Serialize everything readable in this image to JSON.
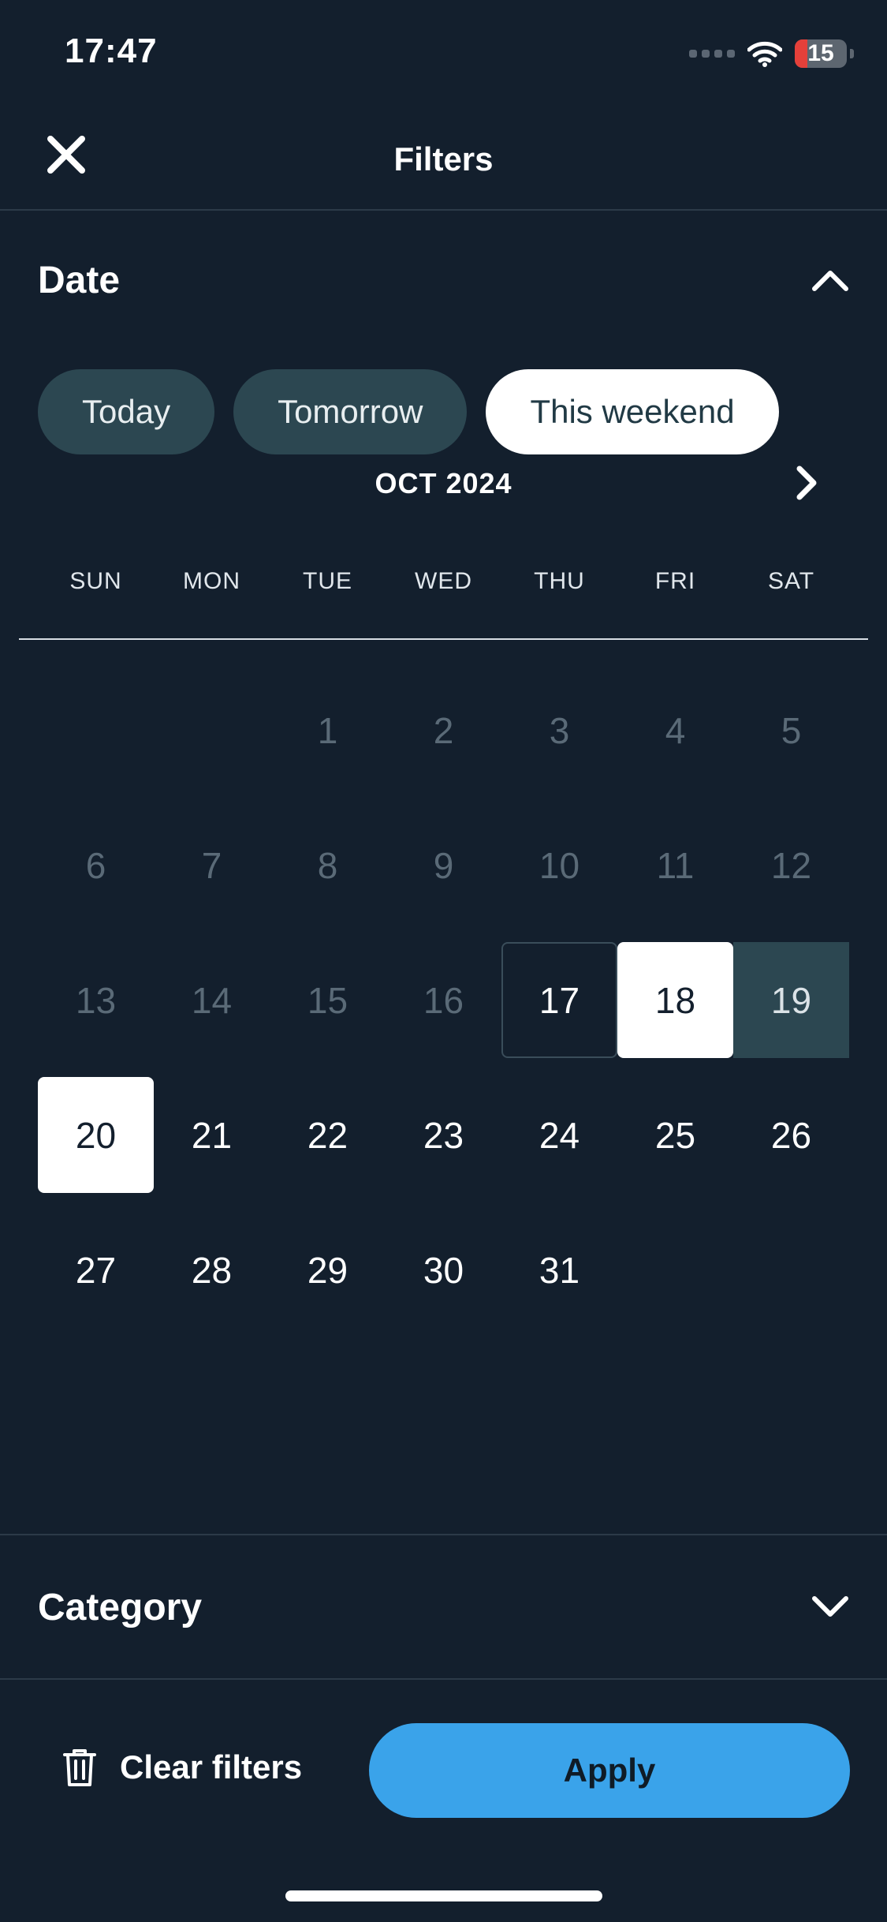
{
  "status": {
    "time": "17:47",
    "battery": "15"
  },
  "header": {
    "title": "Filters"
  },
  "date_section": {
    "title": "Date",
    "chips": [
      {
        "label": "Today",
        "selected": false
      },
      {
        "label": "Tomorrow",
        "selected": false
      },
      {
        "label": "This weekend",
        "selected": true
      }
    ],
    "month_label": "OCT 2024",
    "weekdays": [
      "SUN",
      "MON",
      "TUE",
      "WED",
      "THU",
      "FRI",
      "SAT"
    ],
    "leading_blanks": 2,
    "days_in_month": 31,
    "today": 17,
    "range_start": 18,
    "range_end": 20,
    "muted_through": 16
  },
  "category_section": {
    "title": "Category"
  },
  "footer": {
    "clear_label": "Clear filters",
    "apply_label": "Apply"
  },
  "colors": {
    "background": "#131f2d",
    "accent": "#3aa3ea",
    "chip_dark": "#2c4751",
    "muted_text": "#5a6a77"
  }
}
